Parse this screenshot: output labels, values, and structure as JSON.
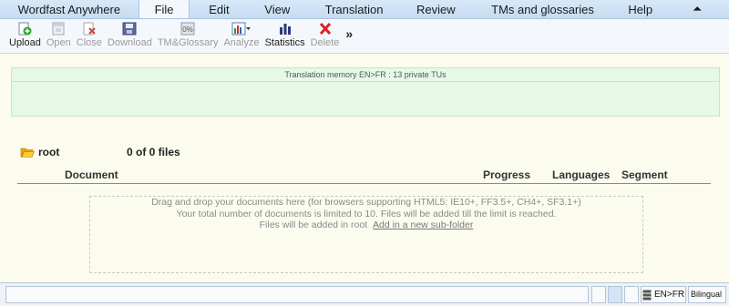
{
  "menu": {
    "items": [
      {
        "label": "Wordfast Anywhere",
        "active": false
      },
      {
        "label": "File",
        "active": true
      },
      {
        "label": "Edit",
        "active": false
      },
      {
        "label": "View",
        "active": false
      },
      {
        "label": "Translation",
        "active": false
      },
      {
        "label": "Review",
        "active": false
      },
      {
        "label": "TMs and glossaries",
        "active": false
      },
      {
        "label": "Help",
        "active": false
      }
    ],
    "collapse_glyph": "⏶"
  },
  "toolbar": {
    "buttons": [
      {
        "label": "Upload",
        "icon": "upload-icon",
        "enabled": true
      },
      {
        "label": "Open",
        "icon": "open-icon",
        "enabled": false
      },
      {
        "label": "Close",
        "icon": "close-file-icon",
        "enabled": false
      },
      {
        "label": "Download",
        "icon": "download-icon",
        "enabled": false
      },
      {
        "label": "TM&Glossary",
        "icon": "tm-glossary-icon",
        "enabled": false
      },
      {
        "label": "Analyze",
        "icon": "analyze-icon",
        "enabled": false
      },
      {
        "label": "Statistics",
        "icon": "statistics-icon",
        "enabled": true
      },
      {
        "label": "Delete",
        "icon": "delete-icon",
        "enabled": false
      }
    ],
    "more_glyph": "»"
  },
  "tm_panel": {
    "title": "Translation memory EN>FR : 13 private TUs"
  },
  "files": {
    "root_name": "root",
    "count_text": "0 of 0 files",
    "columns": {
      "document": "Document",
      "progress": "Progress",
      "languages": "Languages",
      "segment": "Segment"
    },
    "dropzone": {
      "line1": "Drag and drop your documents here (for browsers supporting HTML5: IE10+, FF3.5+, CH4+, SF3.1+)",
      "line2": "Your total number of documents is limited to 10. Files will be added till the limit is reached.",
      "line3_prefix": "Files will be added in root",
      "line3_link": "Add in a new sub-folder"
    }
  },
  "status": {
    "language_pair": "EN>FR",
    "mode": "Bilingual"
  },
  "colors": {
    "accent_green": "#e6f9e8",
    "page_background": "#fbfcee",
    "menubar": "#c6dcf2"
  }
}
